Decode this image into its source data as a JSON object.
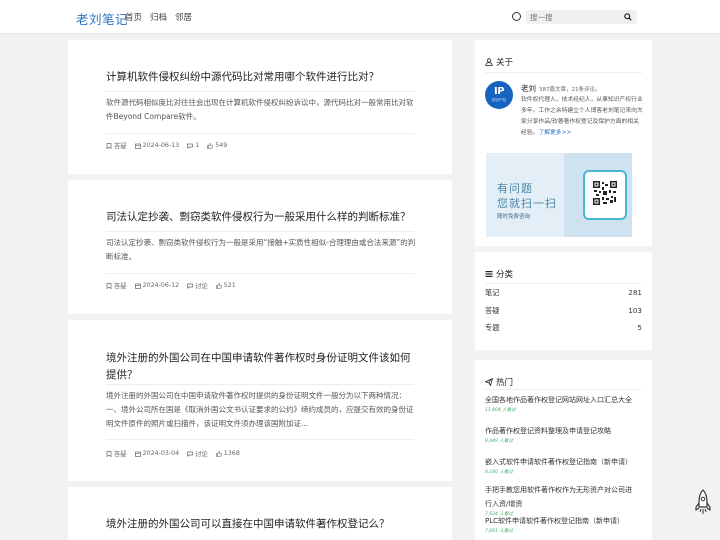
{
  "header": {
    "logo": "老刘笔记",
    "nav": [
      "首页",
      "归档",
      "邻居"
    ],
    "search_placeholder": "搜一搜"
  },
  "posts": [
    {
      "title": "计算机软件侵权纠纷中源代码比对常用哪个软件进行比对？",
      "excerpt": "软件源代码相似度比对往往会出现在计算机软件侵权纠纷诉讼中，源代码比对一般常用比对软件Beyond Compare软件。",
      "category": "答疑",
      "date": "2024-06-13",
      "comments": "1",
      "likes": "549"
    },
    {
      "title": "司法认定抄袭、剽窃类软件侵权行为一般采用什么样的判断标准？",
      "excerpt": "司法认定抄袭、剽窃类软件侵权行为一般是采用“接触+实质性相似-合理理由或合法来源”的判断标准。",
      "category": "答疑",
      "date": "2024-06-12",
      "comments": "讨论",
      "likes": "521"
    },
    {
      "title": "境外注册的外国公司在中国申请软件著作权时身份证明文件该如何提供？",
      "excerpt": "境外注册的外国公司在中国申请软件著作权时提供的身份证明文件一般分为以下两种情况：一、境外公司所在国是《取消外国公文书认证要求的公约》缔约成员的，应提交有效的身份证明文件原件的照片或扫描件，该证明文件须办理该国附加证...",
      "category": "答疑",
      "date": "2024-03-04",
      "comments": "讨论",
      "likes": "1368"
    },
    {
      "title": "境外注册的外国公司可以直接在中国申请软件著作权登记么？"
    }
  ],
  "about": {
    "title": "关于",
    "avatar_text": "IP",
    "avatar_sub": "知识产权",
    "name": "老刘",
    "stats": "387篇文章，21条评论。",
    "desc": "软件权代理人，技术经纪人，从事知识产权行业多年。工作之余特建立个人博客老刘笔记来向大家分享作品/软著著作权登记及保护方面的相关经验。",
    "more": "了解更多>>",
    "qr_line1": "有问题",
    "qr_line2": "您就扫一扫",
    "qr_line3": "随时免费咨询"
  },
  "categories": {
    "title": "分类",
    "items": [
      {
        "name": "笔记",
        "count": "281"
      },
      {
        "name": "答疑",
        "count": "103"
      },
      {
        "name": "专题",
        "count": "5"
      }
    ]
  },
  "hot": {
    "title": "热门",
    "items": [
      {
        "title": "全国各地作品著作权登记网站网址入口汇总大全",
        "views": "11,804 人看过"
      },
      {
        "title": "作品著作权登记资料整理及申请登记攻略",
        "views": "8,449 人看过"
      },
      {
        "title": "嵌入式软件申请软件著作权登记指南（新申请）",
        "views": "8,180 人看过"
      },
      {
        "title": "手把手教您用软件著作权作为无形资产对公司进行入资/增资",
        "views": "7,634 人看过"
      },
      {
        "title": "PLC软件申请软件著作权登记指南（新申请）",
        "views": "7,691 人看过"
      }
    ]
  }
}
